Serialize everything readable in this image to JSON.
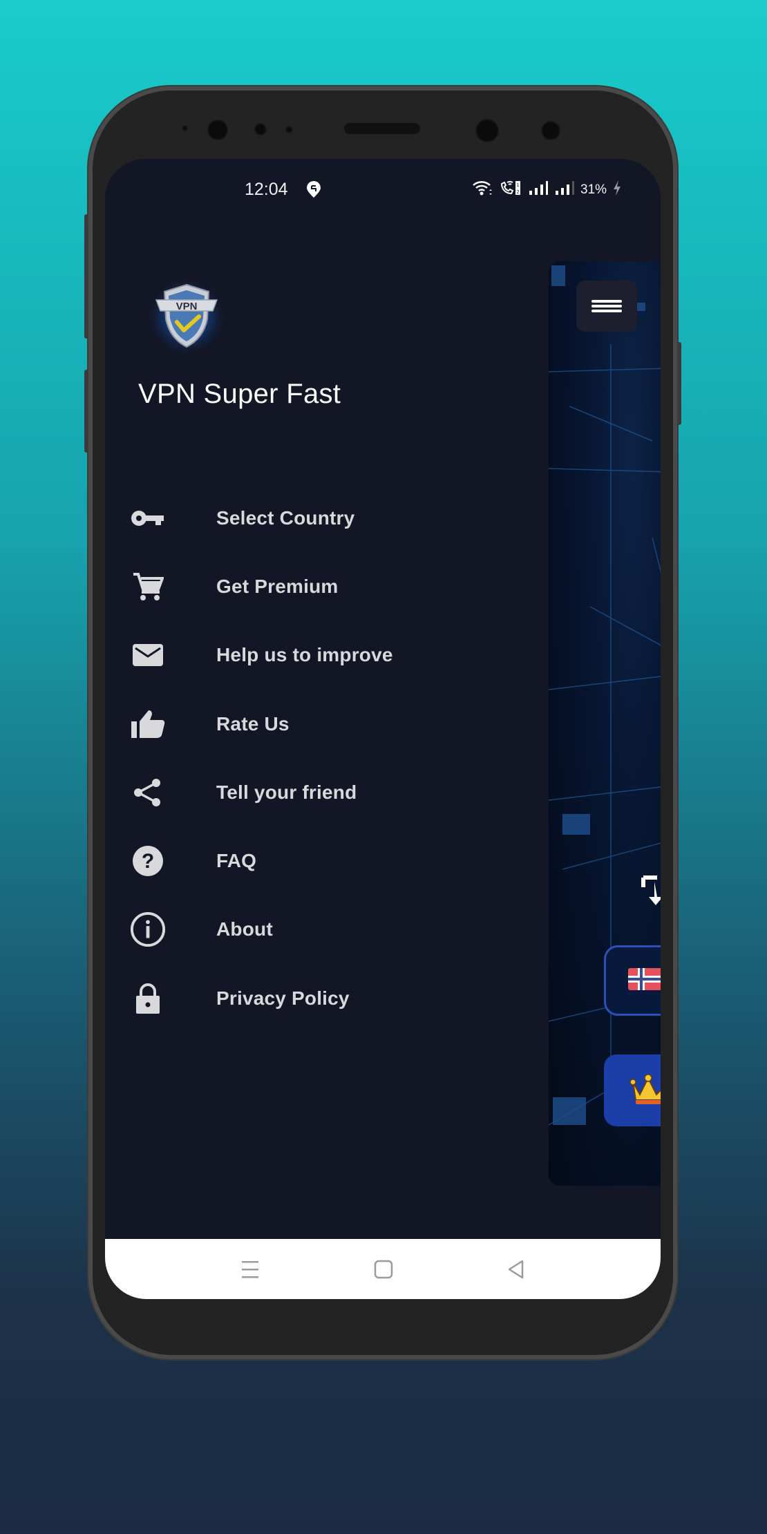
{
  "status_bar": {
    "time": "12:04",
    "battery_percent": "31%",
    "icons": [
      "swiggy-location-icon",
      "wifi-icon",
      "wifi-calling-icon",
      "signal-sim1-icon",
      "signal-sim2-icon",
      "charging-bolt-icon"
    ]
  },
  "drawer": {
    "app_logo": "vpn-shield-logo",
    "app_title": "VPN Super Fast",
    "items": [
      {
        "label": "Select Country",
        "icon": "key-icon"
      },
      {
        "label": "Get Premium",
        "icon": "cart-icon"
      },
      {
        "label": "Help us to improve",
        "icon": "mail-icon"
      },
      {
        "label": "Rate Us",
        "icon": "thumbs-up-icon"
      },
      {
        "label": "Tell your friend",
        "icon": "share-icon"
      },
      {
        "label": "FAQ",
        "icon": "help-circle-icon"
      },
      {
        "label": "About",
        "icon": "info-icon"
      },
      {
        "label": "Privacy Policy",
        "icon": "lock-icon"
      }
    ]
  },
  "main_screen": {
    "menu_button": "hamburger-icon",
    "selected_country_flag": "norway-flag",
    "premium_icon": "crown-icon"
  },
  "nav_bar": {
    "buttons": [
      "recents",
      "home",
      "back"
    ]
  },
  "colors": {
    "drawer_bg": "#131624",
    "menu_text": "#d9d9dc",
    "accent_blue": "#1b3ea8"
  }
}
